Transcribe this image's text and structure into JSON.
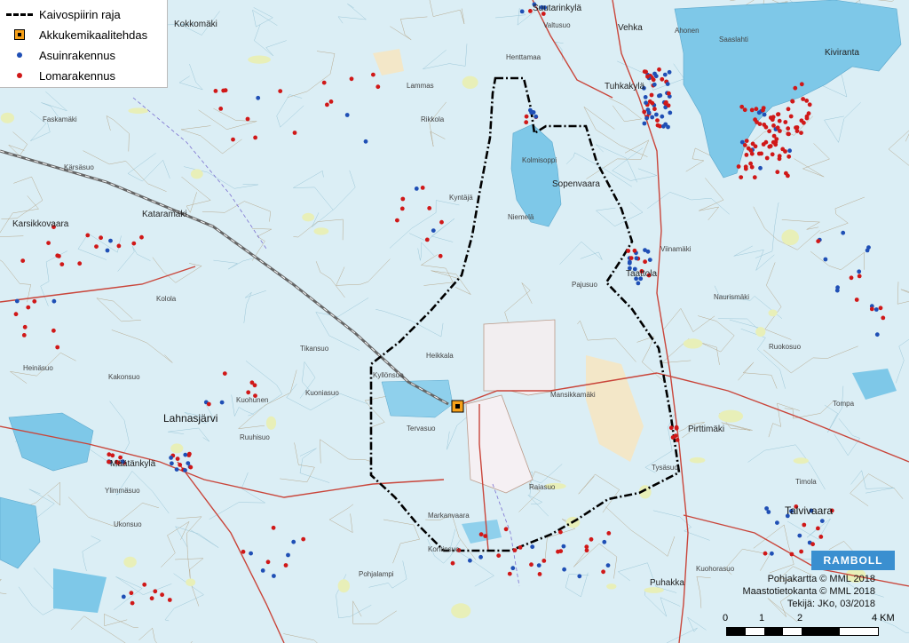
{
  "legend": {
    "items": [
      {
        "label": "Kaivospiirin raja",
        "symbol": "dash-dot-line",
        "color": "#000000"
      },
      {
        "label": "Akkukemikaalitehdas",
        "symbol": "square",
        "color": "#f7a11a"
      },
      {
        "label": "Asuinrakennus",
        "symbol": "dot",
        "color": "#1f4fb5"
      },
      {
        "label": "Lomarakennus",
        "symbol": "dot",
        "color": "#d01818"
      }
    ]
  },
  "places": {
    "big": [
      "Lahnasjärvi",
      "Talvivaara"
    ],
    "medium": [
      "Suutarinkylä",
      "Tuhkakylä",
      "Kataramäki",
      "Karsikkovaara",
      "Sopenvaara",
      "Taattola",
      "Pirttimäki",
      "Määtänkylä",
      "Kiviranta",
      "Puhakka",
      "Kokkomäki",
      "Vehka"
    ],
    "small": [
      "Faskamäki",
      "Kärsäsuo",
      "Kolola",
      "Kuohunen",
      "Kuoniasuo",
      "Tikansuo",
      "Kolmisoppi",
      "Niemelä",
      "Kyntäjä",
      "Tervasuo",
      "Rikkola",
      "Lammas",
      "Henttamaa",
      "Valtusuo",
      "Ahonen",
      "Saaslahti",
      "Mansikkamäki",
      "Viinamäki",
      "Naurismäki",
      "Tysäsuo",
      "Raiasuo",
      "Markanvaara",
      "Pohjalampi",
      "Ylimmäsuo",
      "Ukonsuo",
      "Kuohorasuo",
      "Tompa",
      "Timola",
      "Heinäsuo",
      "Kakonsuo",
      "Ruuhisuo",
      "Pajusuo",
      "Ruokosuo",
      "Heikkala",
      "Kontinsuo",
      "Kyllönsuo"
    ]
  },
  "facility_marker": {
    "label": "Akkukemikaalitehdas"
  },
  "credits": {
    "line1": "Pohjakartta © MML 2018",
    "line2": "Maastotietokanta © MML 2018",
    "line3": "Tekijä: JKo, 03/2018"
  },
  "logo": {
    "text": "RAMBOLL"
  },
  "scale": {
    "ticks": [
      "0",
      "1",
      "2",
      "4 KM"
    ]
  },
  "colors": {
    "water": "#7ec8e8",
    "land": "#dbeef5",
    "field": "#f3e7c8",
    "road": "#c9453a",
    "boundary": "#000000",
    "resident": "#1f4fb5",
    "cottage": "#d01818",
    "facility": "#f7a11a"
  }
}
